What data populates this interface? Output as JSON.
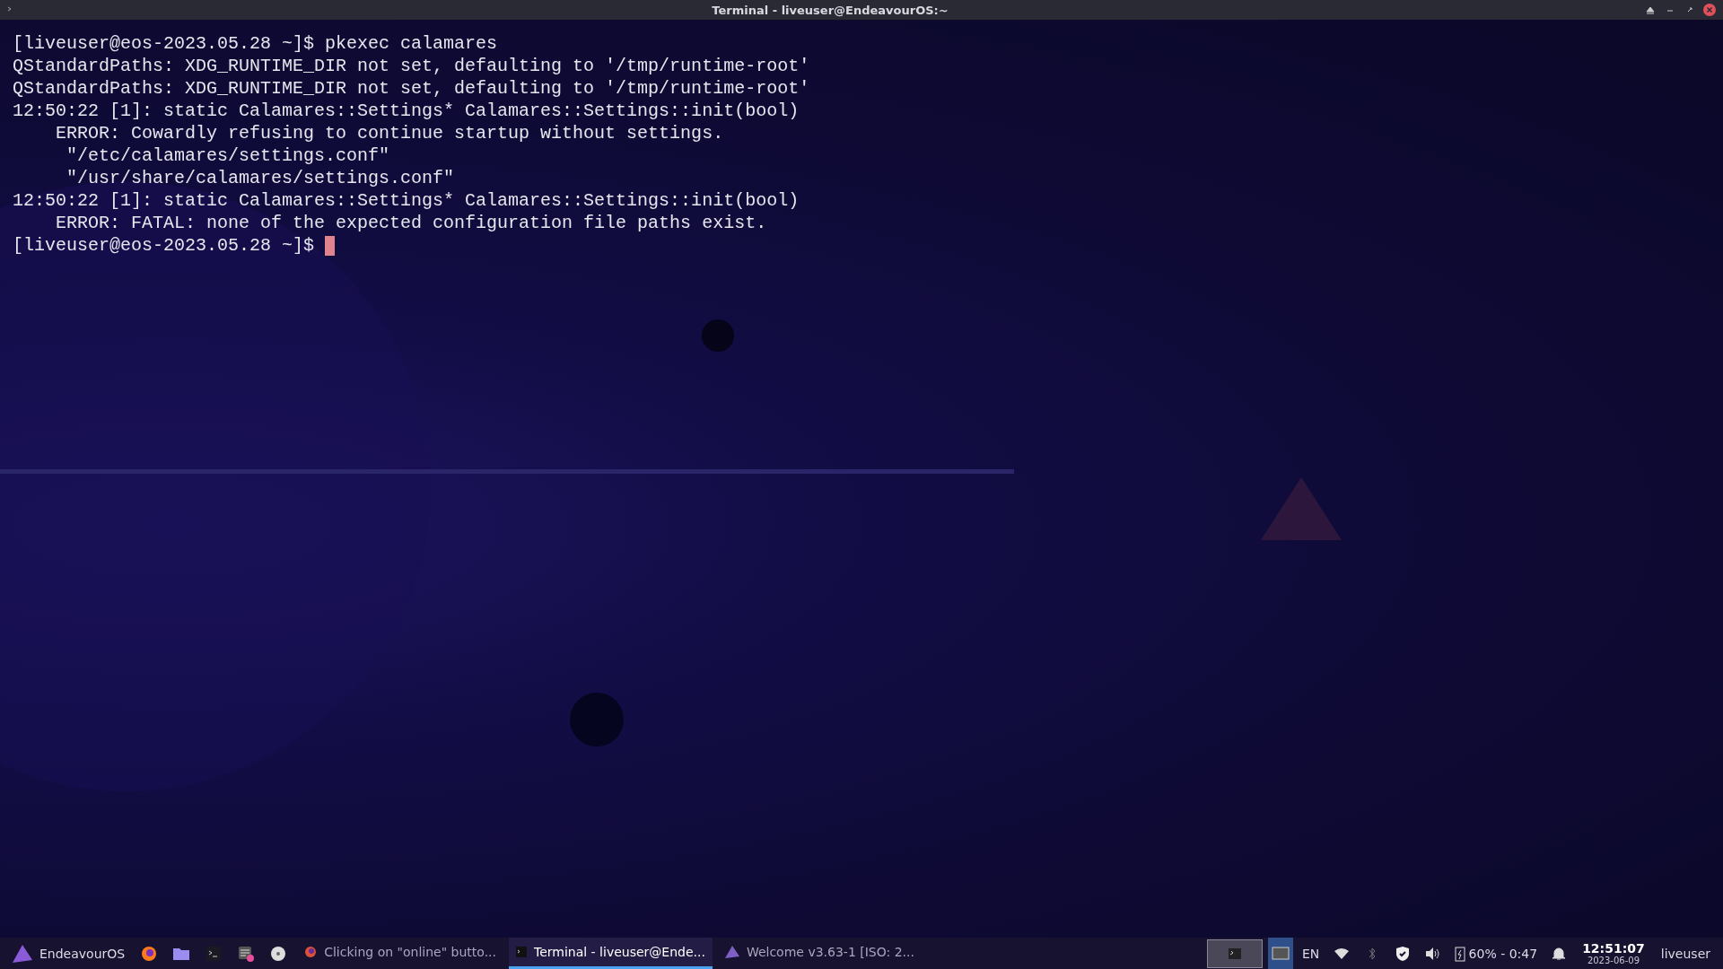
{
  "window": {
    "title": "Terminal - liveuser@EndeavourOS:~"
  },
  "terminal": {
    "lines": [
      "[liveuser@eos-2023.05.28 ~]$ pkexec calamares",
      "QStandardPaths: XDG_RUNTIME_DIR not set, defaulting to '/tmp/runtime-root'",
      "QStandardPaths: XDG_RUNTIME_DIR not set, defaulting to '/tmp/runtime-root'",
      "12:50:22 [1]: static Calamares::Settings* Calamares::Settings::init(bool)",
      "    ERROR: Cowardly refusing to continue startup without settings.",
      "     \"/etc/calamares/settings.conf\"",
      "     \"/usr/share/calamares/settings.conf\"",
      "12:50:22 [1]: static Calamares::Settings* Calamares::Settings::init(bool)",
      "    ERROR: FATAL: none of the expected configuration file paths exist."
    ],
    "prompt": "[liveuser@eos-2023.05.28 ~]$"
  },
  "taskbar": {
    "menu_label": "EndeavourOS",
    "launchers": [
      {
        "kind": "firefox"
      },
      {
        "kind": "files"
      },
      {
        "kind": "terminal"
      },
      {
        "kind": "settings"
      },
      {
        "kind": "disk"
      }
    ],
    "tasks": [
      {
        "label": "Clicking on \"online\" butto...",
        "kind": "browser",
        "selected": false
      },
      {
        "label": "Terminal - liveuser@Ende...",
        "kind": "terminal",
        "selected": true
      },
      {
        "label": "Welcome v3.63-1  [ISO: 2...",
        "kind": "welcome",
        "selected": false
      }
    ],
    "keyboard_layout": "EN",
    "battery": "60% - 0:47",
    "time": "12:51:07",
    "date": "2023-06-09",
    "user": "liveuser"
  }
}
